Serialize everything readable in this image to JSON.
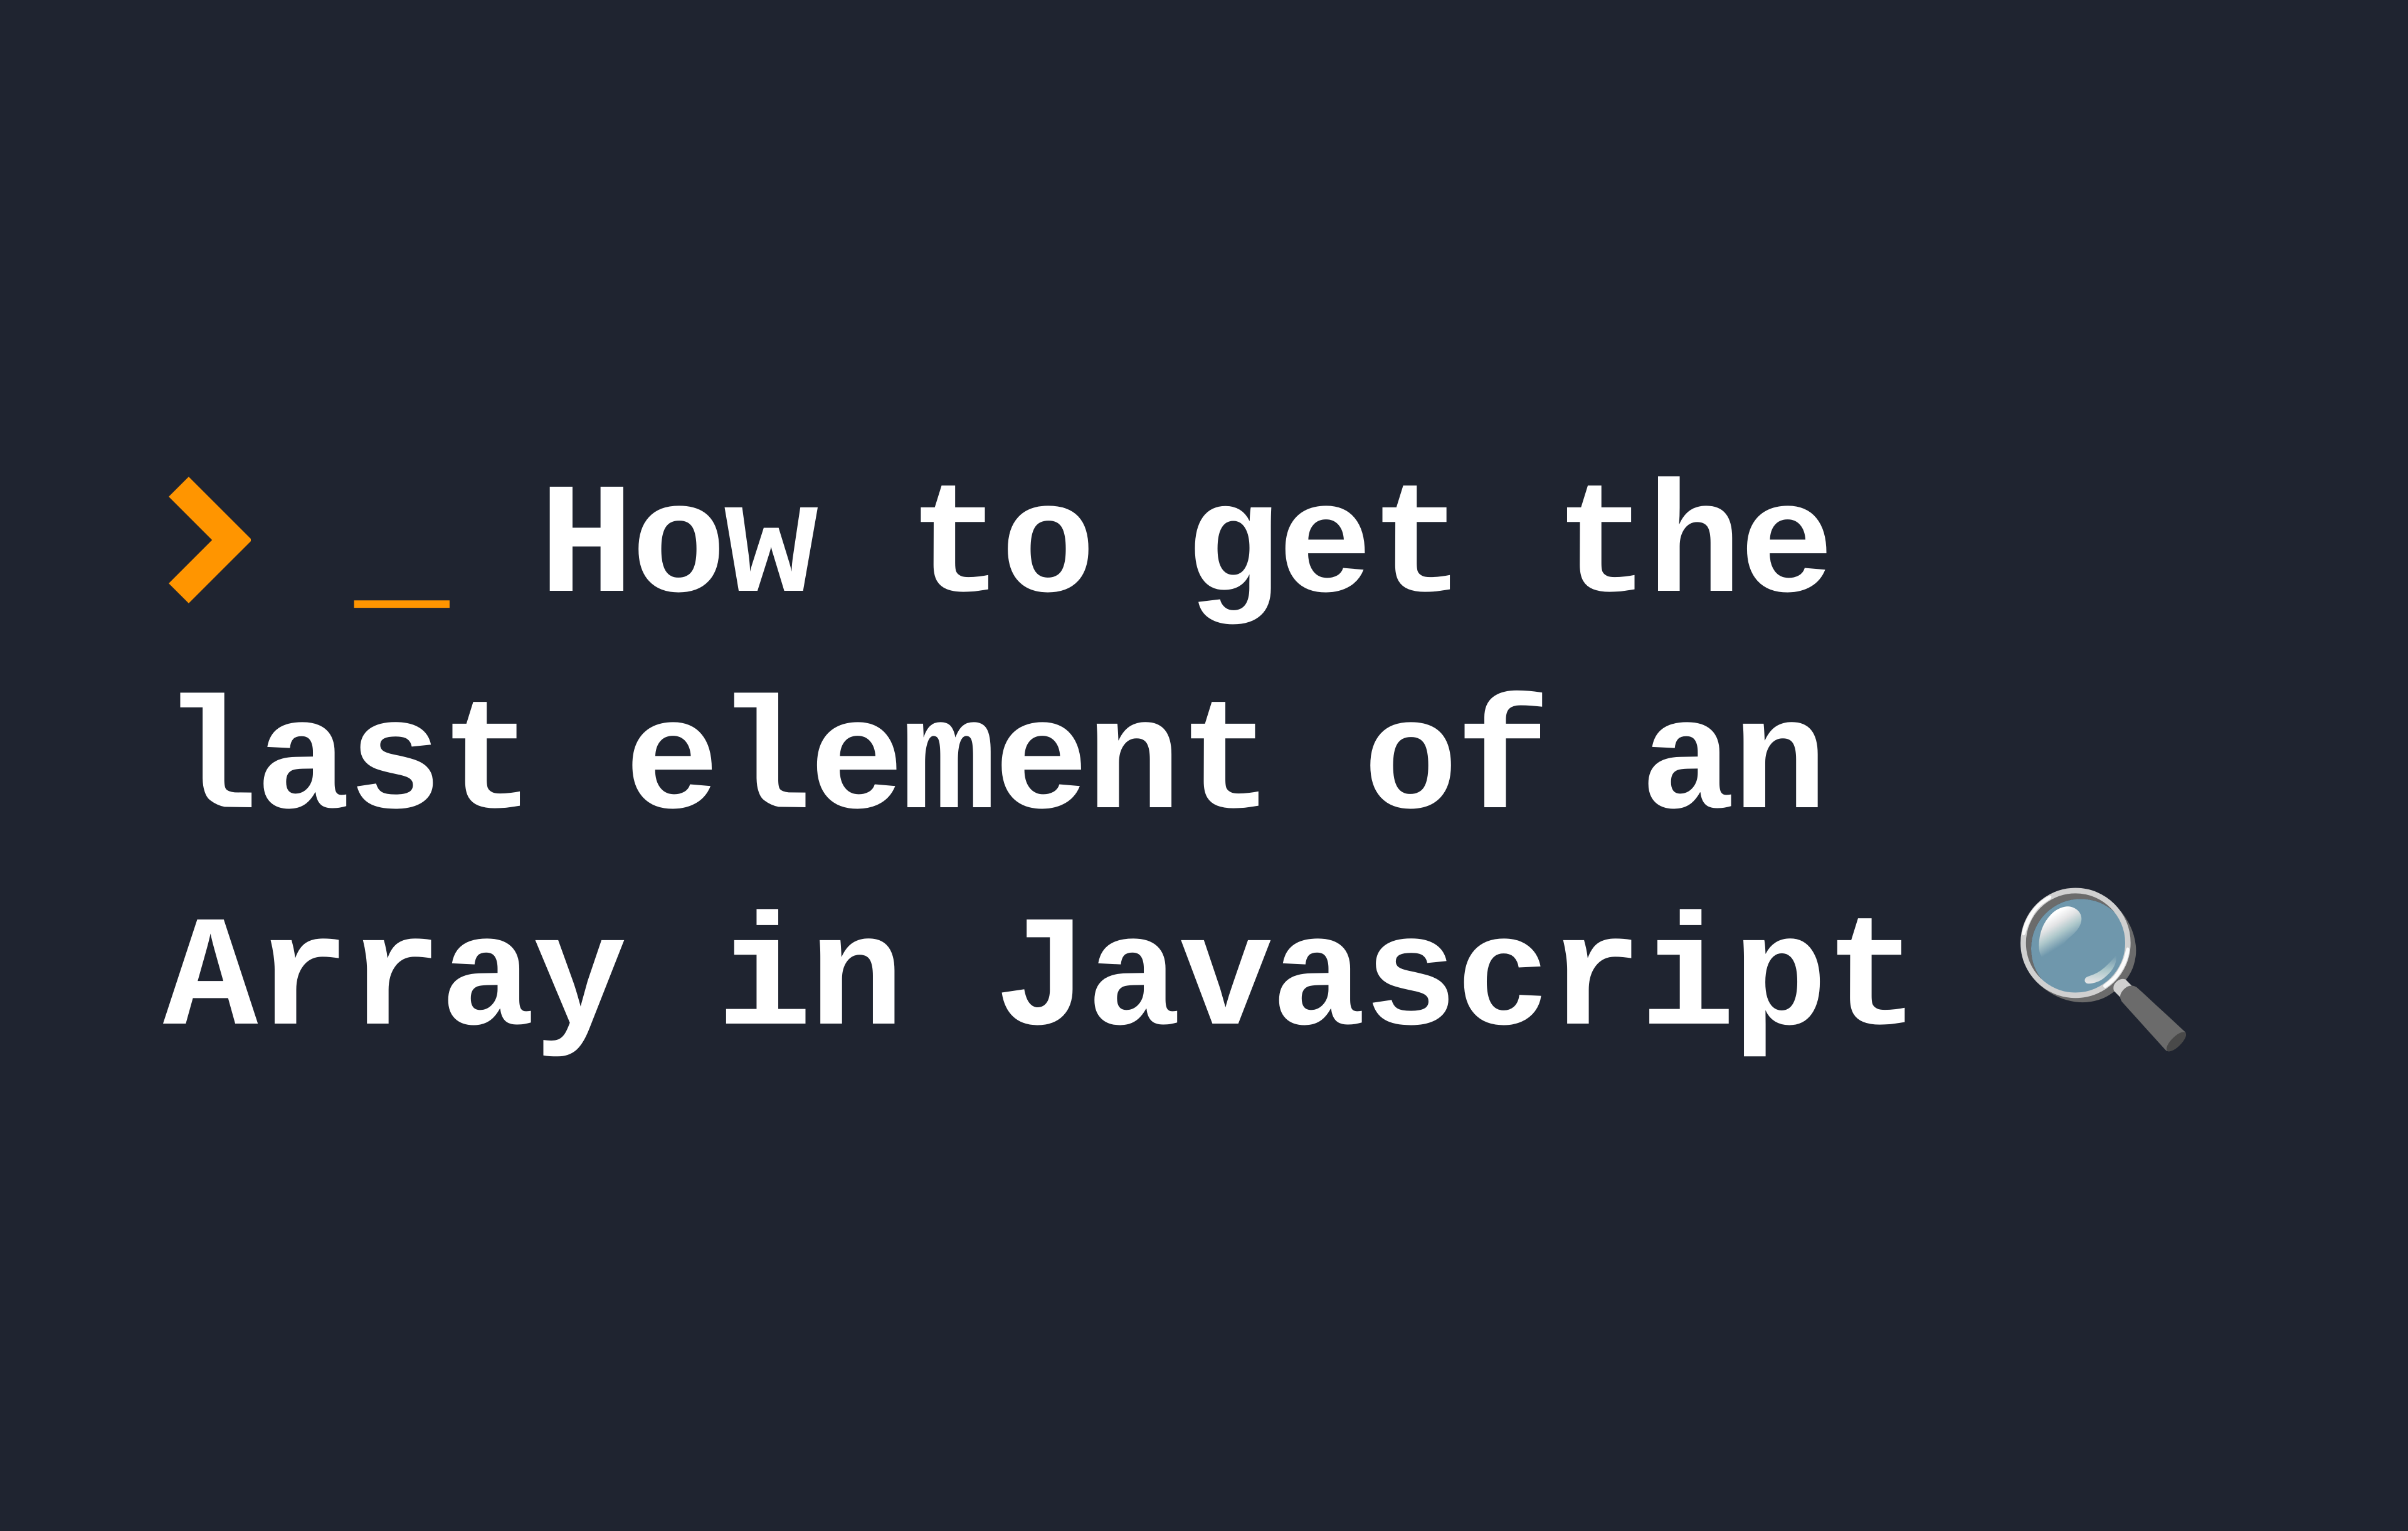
{
  "title": {
    "prompt_chevron": "›",
    "prompt_underscore": "_",
    "text": "How to get the last element of an Array in Javascript",
    "magnifier_emoji": "🔍"
  },
  "colors": {
    "background": "#1f2430",
    "accent": "#ff9500",
    "text": "#ffffff"
  }
}
